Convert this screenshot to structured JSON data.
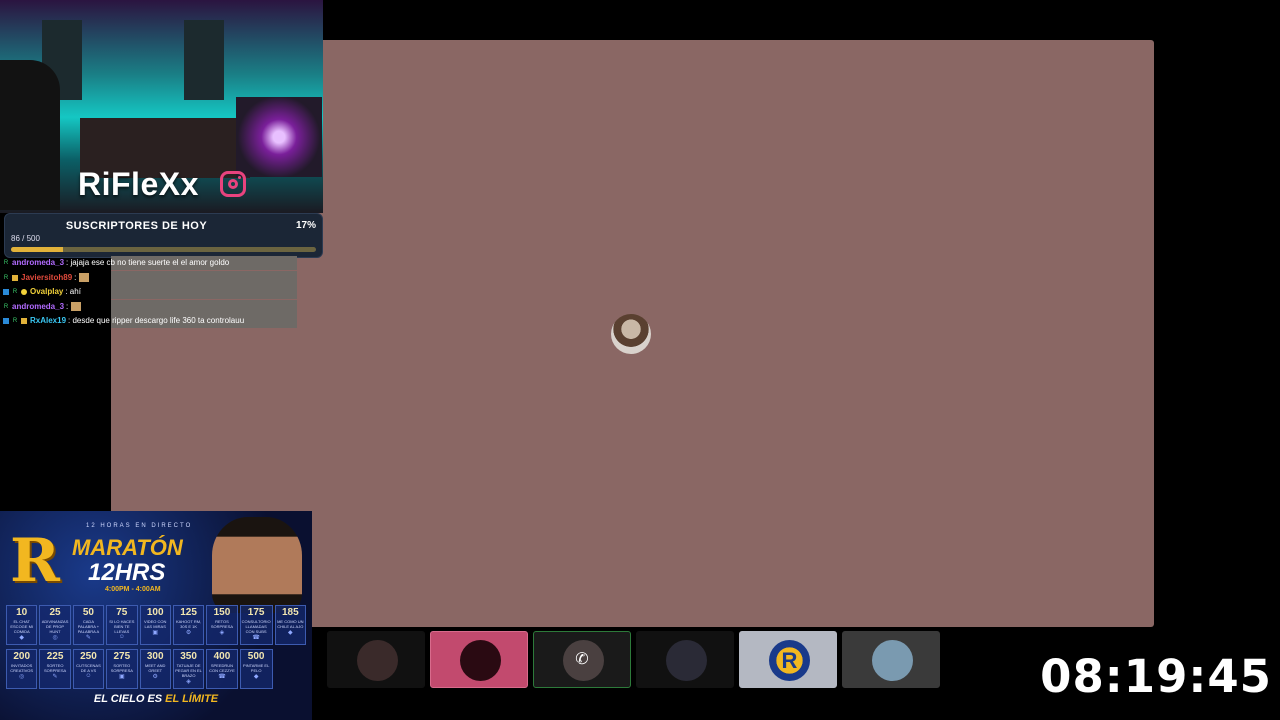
{
  "streamer": {
    "name": "RiFleXx",
    "social_icon": "instagram-icon",
    "accent": "#e8437e"
  },
  "sub_goal": {
    "title": "SUSCRIPTORES DE HOY",
    "current": 86,
    "target": 500,
    "count_label": "86 / 500",
    "percent_label": "17%",
    "fill_fraction": 0.17
  },
  "chat": [
    {
      "badges": [
        "R"
      ],
      "user": "andromeda_3",
      "user_color": "#b26bff",
      "text": ": jajaja ese cb no tiene suerte el el amor goldo",
      "emote": false
    },
    {
      "badges": [
        "R",
        "sub"
      ],
      "user": "Javiersitoh89",
      "user_color": "#e24a3c",
      "text": ":",
      "emote": true
    },
    {
      "badges": [
        "mod",
        "R",
        "$"
      ],
      "user": "Ovalplay",
      "user_color": "#f2d23a",
      "text": ": ahí",
      "emote": false
    },
    {
      "badges": [
        "R"
      ],
      "user": "andromeda_3",
      "user_color": "#b26bff",
      "text": ":",
      "emote": true
    },
    {
      "badges": [
        "mod",
        "R",
        "sub"
      ],
      "user": "RxAlex19",
      "user_color": "#3ac7f2",
      "text": ": desde que ripper descargo life 360 ta controlauu",
      "emote": false
    }
  ],
  "promo": {
    "top_text": "12 HORAS EN DIRECTO",
    "title_line1": "MARATÓN",
    "title_line2": "12HRS",
    "time_range": "4:00PM - 4:00AM",
    "footer_plain": "EL CIELO ES ",
    "footer_gold": "EL LÍMITE",
    "goals": [
      {
        "num": "10",
        "desc": "EL CHAT ESCOGE MI COMIDA"
      },
      {
        "num": "25",
        "desc": "ADIVINANZAS DE PROP HUNT"
      },
      {
        "num": "50",
        "desc": "CADA PALABRA + PALABRA A"
      },
      {
        "num": "75",
        "desc": "SI LO HACES BIEN TE LLEVAS"
      },
      {
        "num": "100",
        "desc": "VIDEO CON LAS MIRAS"
      },
      {
        "num": "125",
        "desc": "KAHOOT RM, 30S E 1K"
      },
      {
        "num": "150",
        "desc": "RETOS SORPRESA"
      },
      {
        "num": "175",
        "desc": "CONSULTORIO LLAMADAS CON SUBS"
      },
      {
        "num": "185",
        "desc": "ME COMO UN CHILE AL AJO"
      },
      {
        "num": "200",
        "desc": "INVITADOS CREATIVOS"
      },
      {
        "num": "225",
        "desc": "SORTEO SORPRESA"
      },
      {
        "num": "250",
        "desc": "CUTSCENAS DE A VS"
      },
      {
        "num": "275",
        "desc": "SORTEO SORPRESA"
      },
      {
        "num": "300",
        "desc": "MEET AND GREET"
      },
      {
        "num": "350",
        "desc": "TATUAJE DE PEGAR EN EL BRAZO"
      },
      {
        "num": "400",
        "desc": "SPEEDRUN CON CEZZYE"
      },
      {
        "num": "500",
        "desc": "PINTARME EL PELO"
      }
    ]
  },
  "participants": [
    {
      "id": "p1",
      "bg": "#111111",
      "border": "#111111",
      "avatar": "#3a2a2a",
      "icon": "dark-avatar"
    },
    {
      "id": "p2",
      "bg": "#c24a6e",
      "border": "#d86b8c",
      "avatar": "#2a0a12",
      "icon": "red-avatar"
    },
    {
      "id": "p3",
      "bg": "#1a1a1a",
      "border": "#2d7a3a",
      "avatar": "#4a4040",
      "icon": "phone-icon"
    },
    {
      "id": "p4",
      "bg": "#111111",
      "border": "#111111",
      "avatar": "#2a2a36",
      "icon": "dark-avatar"
    },
    {
      "id": "p5",
      "bg": "#b4b8c2",
      "border": "#b4b8c2",
      "avatar": "#1a3a8a",
      "icon": "r-logo"
    },
    {
      "id": "p6",
      "bg": "#3a3a3a",
      "border": "#3a3a3a",
      "avatar": "#7a9ab0",
      "icon": "cowboy-avatar"
    }
  ],
  "clock": "08:19:45"
}
